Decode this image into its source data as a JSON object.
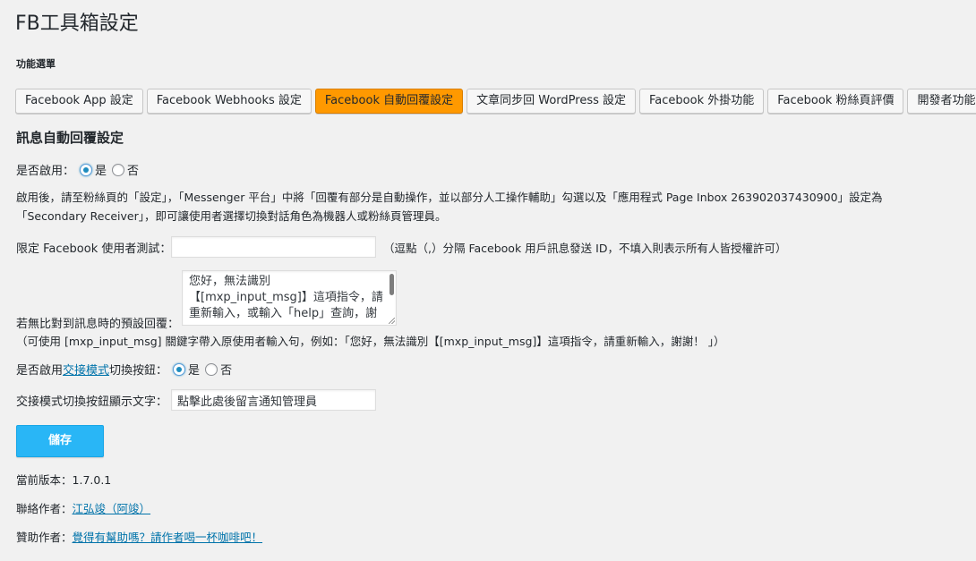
{
  "page": {
    "title": "FB工具箱設定",
    "menu_label": "功能選單"
  },
  "tabs": [
    {
      "label": "Facebook App 設定",
      "active": false
    },
    {
      "label": "Facebook Webhooks 設定",
      "active": false
    },
    {
      "label": "Facebook 自動回覆設定",
      "active": true
    },
    {
      "label": "文章同步回 WordPress 設定",
      "active": false
    },
    {
      "label": "Facebook 外掛功能",
      "active": false
    },
    {
      "label": "Facebook 粉絲頁評價",
      "active": false
    },
    {
      "label": "開發者功能",
      "active": false
    }
  ],
  "section": {
    "title": "訊息自動回覆設定"
  },
  "enable": {
    "label": "是否啟用：",
    "yes": "是",
    "no": "否",
    "selected": "yes"
  },
  "instructions": {
    "line1": "啟用後，請至粉絲頁的「設定」，「Messenger 平台」中將「回覆有部分是自動操作，並以部分人工操作輔助」勾選以及「應用程式 Page Inbox 263902037430900」設定為",
    "line2": "「Secondary Receiver」，即可讓使用者選擇切換對話角色為機器人或粉絲頁管理員。"
  },
  "test_users": {
    "label": "限定 Facebook 使用者測試：",
    "value": "",
    "hint": "（逗點（,）分隔 Facebook 用戶訊息發送 ID，不填入則表示所有人皆授權許可）"
  },
  "default_reply": {
    "label": "若無比對到訊息時的預設回覆：",
    "line1": "您好，無法識別",
    "line2": "【[mxp_input_msg]】這項指令，請",
    "line3": "重新輸入，或輸入「help」查詢，謝",
    "note": "（可使用 [mxp_input_msg] 關鍵字帶入原使用者輸入句，例如：「您好，無法識別【[mxp_input_msg]】這項指令，請重新輸入，謝謝！ 」）"
  },
  "handover": {
    "label_prefix": "是否啟用",
    "label_link": "交接模式",
    "label_suffix": "切換按鈕：",
    "yes": "是",
    "no": "否",
    "selected": "yes"
  },
  "handover_text": {
    "label": "交接模式切換按鈕顯示文字：",
    "value": "點擊此處後留言通知管理員"
  },
  "save_button": {
    "label": "儲存"
  },
  "footer": {
    "version_label": "當前版本：",
    "version": "1.7.0.1",
    "author_label": "聯絡作者：",
    "author_link": "江弘竣（阿竣）",
    "sponsor_label": "贊助作者：",
    "sponsor_link": "覺得有幫助嗎？請作者喝一杯咖啡吧！"
  },
  "colors": {
    "active_tab": "#ff9900",
    "save_button": "#29b6f6",
    "link": "#0073aa",
    "radio_checked": "#1e8cbe"
  }
}
